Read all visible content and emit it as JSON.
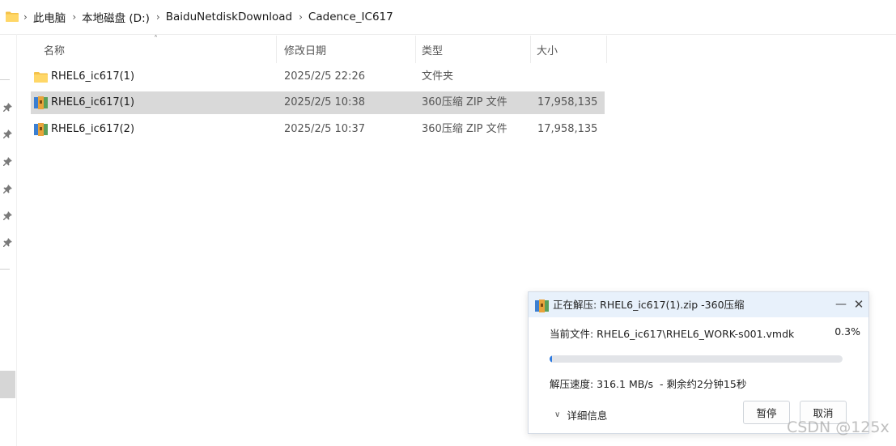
{
  "breadcrumb": [
    "此电脑",
    "本地磁盘 (D:)",
    "BaiduNetdiskDownload",
    "Cadence_IC617"
  ],
  "columns": {
    "name": "名称",
    "modified": "修改日期",
    "type": "类型",
    "size": "大小"
  },
  "files": [
    {
      "icon": "folder-icon",
      "name": "RHEL6_ic617(1)",
      "modified": "2025/2/5 22:26",
      "type": "文件夹",
      "size": ""
    },
    {
      "icon": "zip-archive-icon",
      "name": "RHEL6_ic617(1)",
      "modified": "2025/2/5 10:38",
      "type": "360压缩 ZIP 文件",
      "size": "17,958,135 ...",
      "selected": true
    },
    {
      "icon": "zip-archive-icon",
      "name": "RHEL6_ic617(2)",
      "modified": "2025/2/5 10:37",
      "type": "360压缩 ZIP 文件",
      "size": "17,958,135 ..."
    }
  ],
  "dialog": {
    "title": "正在解压: RHEL6_ic617(1).zip -360压缩",
    "current_file": "当前文件: RHEL6_ic617\\RHEL6_WORK-s001.vmdk",
    "percent": "0.3%",
    "progress": 0.003,
    "speed": "解压速度: 316.1 MB/s",
    "remaining": "- 剩余约2分钟15秒",
    "details_label": "详细信息",
    "pause_label": "暂停",
    "cancel_label": "取消"
  },
  "watermark": "CSDN @125x",
  "colors": {
    "selected_row": "#d9d9d9",
    "dialog_title_bg": "#e8f1fb",
    "progress_fill": "#2d7ae0",
    "folder_yellow": "#f4c24a"
  }
}
